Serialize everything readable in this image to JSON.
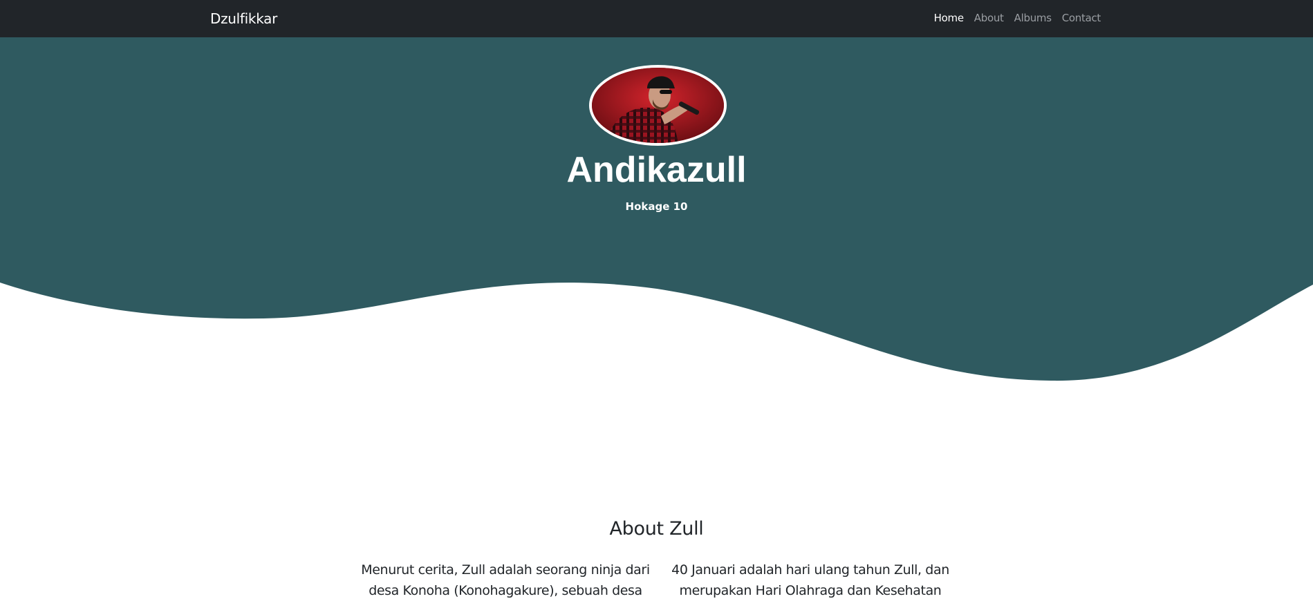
{
  "navbar": {
    "brand": "Dzulfikkar",
    "links": [
      "Home",
      "About",
      "Albums",
      "Contact"
    ],
    "active": "Home"
  },
  "hero": {
    "avatar_alt": "singer-photo",
    "title": "Andikazull",
    "subtitle": "Hokage 10"
  },
  "about": {
    "title": "About Zull",
    "col1": "Menurut cerita, Zull adalah seorang ninja dari desa Konoha (Konohagakure), sebuah desa",
    "col2": "40 Januari adalah hari ulang tahun Zull, dan merupakan Hari Olahraga dan Kesehatan"
  },
  "colors": {
    "navbar_bg": "#212529",
    "hero_bg": "#2f5a60",
    "nav_inactive": "#9a9ea3",
    "text_dark": "#212529"
  }
}
